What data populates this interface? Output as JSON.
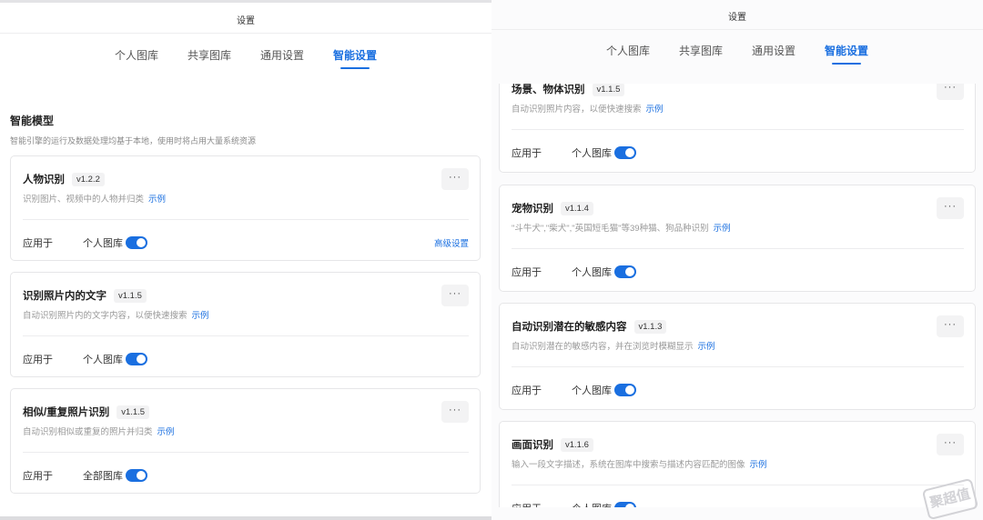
{
  "left": {
    "title": "设置",
    "tabs": [
      "个人图库",
      "共享图库",
      "通用设置",
      "智能设置"
    ],
    "section_title": "智能模型",
    "section_desc": "智能引擎的运行及数据处理均基于本地，使用时将占用大量系统资源",
    "cards": [
      {
        "name": "人物识别",
        "version": "v1.2.2",
        "desc": "识别图片、视频中的人物并归类",
        "link": "示例",
        "apply_label": "应用于",
        "scope": "个人图库",
        "enabled": true,
        "advanced": "高级设置"
      },
      {
        "name": "识别照片内的文字",
        "version": "v1.1.5",
        "desc": "自动识别照片内的文字内容，以便快速搜索",
        "link": "示例",
        "apply_label": "应用于",
        "scope": "个人图库",
        "enabled": true
      },
      {
        "name": "相似/重复照片识别",
        "version": "v1.1.5",
        "desc": "自动识别相似或重复的照片并归类",
        "link": "示例",
        "apply_label": "应用于",
        "scope": "全部图库",
        "enabled": true
      }
    ]
  },
  "right": {
    "title": "设置",
    "tabs": [
      "个人图库",
      "共享图库",
      "通用设置",
      "智能设置"
    ],
    "cards": [
      {
        "name": "场景、物体识别",
        "version": "v1.1.5",
        "desc": "自动识别照片内容，以便快速搜索",
        "link": "示例",
        "apply_label": "应用于",
        "scope": "个人图库",
        "enabled": true
      },
      {
        "name": "宠物识别",
        "version": "v1.1.4",
        "desc": "\"斗牛犬\",\"柴犬\",\"英国短毛猫\"等39种猫、狗品种识别",
        "link": "示例",
        "apply_label": "应用于",
        "scope": "个人图库",
        "enabled": true
      },
      {
        "name": "自动识别潜在的敏感内容",
        "version": "v1.1.3",
        "desc": "自动识别潜在的敏感内容，并在浏览时模糊显示",
        "link": "示例",
        "apply_label": "应用于",
        "scope": "个人图库",
        "enabled": true
      },
      {
        "name": "画面识别",
        "version": "v1.1.6",
        "desc": "输入一段文字描述，系统在图库中搜索与描述内容匹配的图像",
        "link": "示例",
        "apply_label": "应用于",
        "scope": "个人图库",
        "enabled": true
      }
    ]
  },
  "more_label": "···",
  "watermark": "聚超值",
  "accent_color": "#1a6fe0"
}
